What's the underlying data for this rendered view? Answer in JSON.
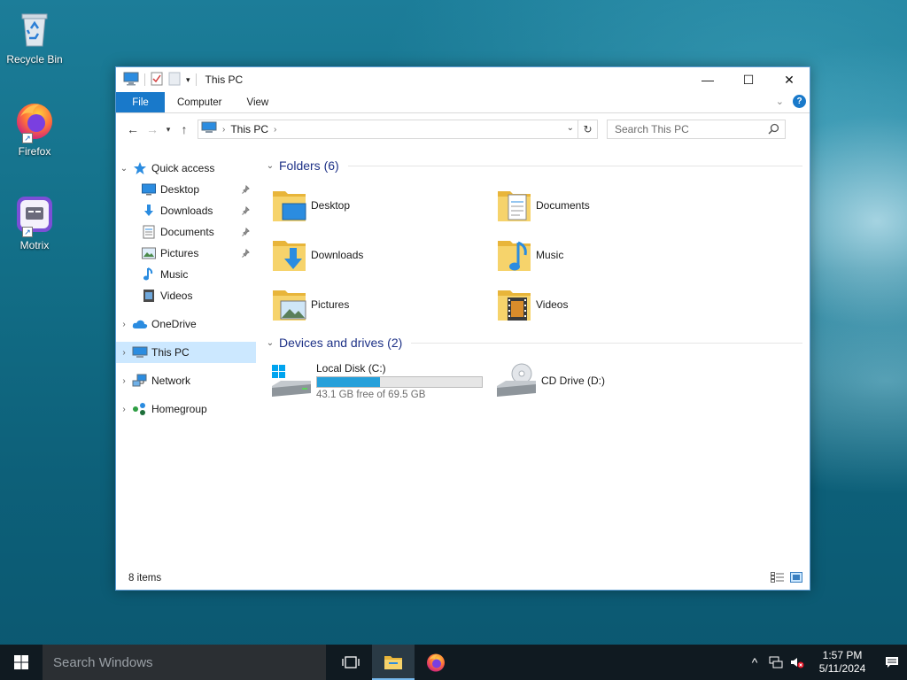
{
  "desktop": {
    "icons": [
      {
        "label": "Recycle Bin",
        "icon": "recycle-bin-icon"
      },
      {
        "label": "Firefox",
        "icon": "firefox-icon"
      },
      {
        "label": "Motrix",
        "icon": "motrix-icon"
      }
    ]
  },
  "window": {
    "title": "This PC",
    "controls": {
      "minimize": "—",
      "maximize": "☐",
      "close": "✕"
    },
    "ribbon_tabs": [
      "File",
      "Computer",
      "View"
    ],
    "address": {
      "crumb": "This PC"
    },
    "search": {
      "placeholder": "Search This PC"
    },
    "nav_pane": {
      "quick_access": "Quick access",
      "quick_items": [
        {
          "label": "Desktop",
          "icon": "desktop-icon",
          "pinned": true
        },
        {
          "label": "Downloads",
          "icon": "downloads-icon",
          "pinned": true
        },
        {
          "label": "Documents",
          "icon": "documents-icon",
          "pinned": true
        },
        {
          "label": "Pictures",
          "icon": "pictures-icon",
          "pinned": true
        },
        {
          "label": "Music",
          "icon": "music-icon",
          "pinned": false
        },
        {
          "label": "Videos",
          "icon": "videos-icon",
          "pinned": false
        }
      ],
      "onedrive": "OneDrive",
      "this_pc": "This PC",
      "network": "Network",
      "homegroup": "Homegroup"
    },
    "folders_group": {
      "title": "Folders (6)",
      "items": [
        {
          "label": "Desktop",
          "icon": "desktop-folder-icon"
        },
        {
          "label": "Documents",
          "icon": "documents-folder-icon"
        },
        {
          "label": "Downloads",
          "icon": "downloads-folder-icon"
        },
        {
          "label": "Music",
          "icon": "music-folder-icon"
        },
        {
          "label": "Pictures",
          "icon": "pictures-folder-icon"
        },
        {
          "label": "Videos",
          "icon": "videos-folder-icon"
        }
      ]
    },
    "drives_group": {
      "title": "Devices and drives (2)",
      "local_disk": {
        "name": "Local Disk (C:)",
        "free_text": "43.1 GB free of 69.5 GB",
        "used_fraction": 0.38
      },
      "cd_drive": {
        "name": "CD Drive (D:)"
      }
    },
    "status": {
      "items_count": "8 items"
    }
  },
  "taskbar": {
    "search_placeholder": "Search Windows",
    "clock_time": "1:57 PM",
    "clock_date": "5/11/2024"
  },
  "colors": {
    "accent": "#1979ca",
    "selection": "#cce8ff",
    "drive_bar": "#26a0da",
    "folder": "#f0c64e"
  }
}
